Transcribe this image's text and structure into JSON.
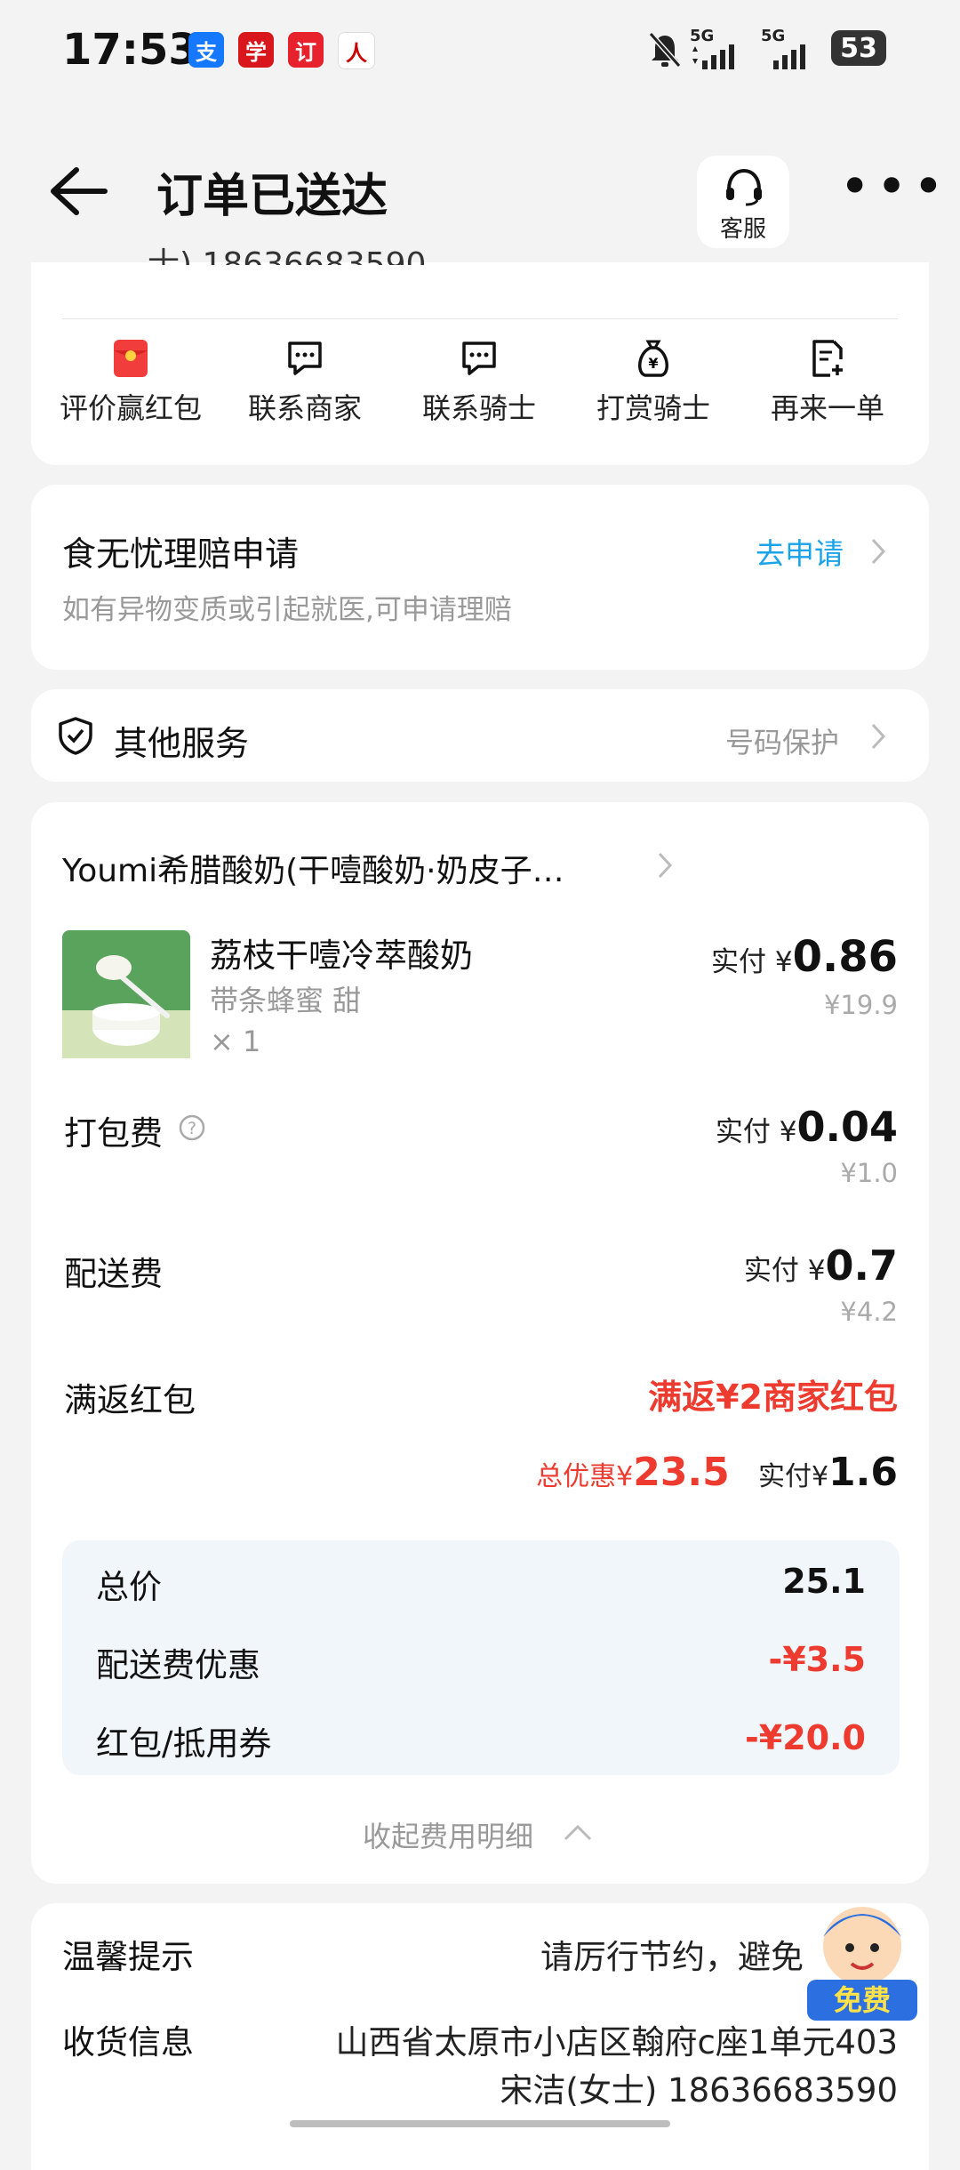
{
  "status_bar": {
    "time": "17:53",
    "battery": "53",
    "network1": "5G",
    "network2": "5G",
    "apps": [
      {
        "icon": "alipay-icon",
        "glyph": "支",
        "color": "#1677ff"
      },
      {
        "icon": "xuexi-icon",
        "glyph": "学",
        "color": "#d8161b"
      },
      {
        "icon": "toutiao-icon",
        "glyph": "订",
        "color": "#e8222c"
      },
      {
        "icon": "renmin-icon",
        "glyph": "人",
        "color": "#ffffff"
      }
    ]
  },
  "header": {
    "title": "订单已送达",
    "service_label": "客服"
  },
  "top_card": {
    "partial_text": "士) 18636683590",
    "actions": [
      {
        "label": "评价赢红包",
        "icon": "red-packet-icon"
      },
      {
        "label": "联系商家",
        "icon": "chat-icon"
      },
      {
        "label": "联系骑士",
        "icon": "chat-icon"
      },
      {
        "label": "打赏骑士",
        "icon": "money-bag-icon"
      },
      {
        "label": "再来一单",
        "icon": "reorder-icon"
      }
    ]
  },
  "claim": {
    "title": "食无忧理赔申请",
    "subtitle": "如有异物变质或引起就医,可申请理赔",
    "link": "去申请"
  },
  "services": {
    "title": "其他服务",
    "value": "号码保护"
  },
  "order": {
    "store_name": "Youmi希腊酸奶(干噎酸奶·奶皮子…",
    "item": {
      "name": "荔枝干噎冷萃酸奶",
      "spec": "带条蜂蜜 甜",
      "qty": "× 1",
      "paid_label": "实付 ¥",
      "paid": "0.86",
      "original": "¥19.9"
    },
    "packing": {
      "label": "打包费",
      "paid_label": "实付 ¥",
      "paid": "0.04",
      "original": "¥1.0"
    },
    "delivery": {
      "label": "配送费",
      "paid_label": "实付 ¥",
      "paid": "0.7",
      "original": "¥4.2"
    },
    "cashback": {
      "label": "满返红包",
      "value": "满返¥2商家红包"
    },
    "totals": {
      "discount_label": "总优惠¥",
      "discount": "23.5",
      "paid_label": "实付¥",
      "paid": "1.6"
    },
    "breakdown": [
      {
        "label": "总价",
        "value": "25.1"
      },
      {
        "label": "配送费优惠",
        "value": "-¥3.5"
      },
      {
        "label": "红包/抵用券",
        "value": "-¥20.0"
      }
    ],
    "collapse_label": "收起费用明细"
  },
  "bottom": {
    "tip_label": "温馨提示",
    "tip_value": "请厉行节约，避免",
    "address_label": "收货信息",
    "address": "山西省太原市小店区翰府c座1单元403",
    "contact": "宋洁(女士) 18636683590",
    "promo_badge": "免费"
  }
}
